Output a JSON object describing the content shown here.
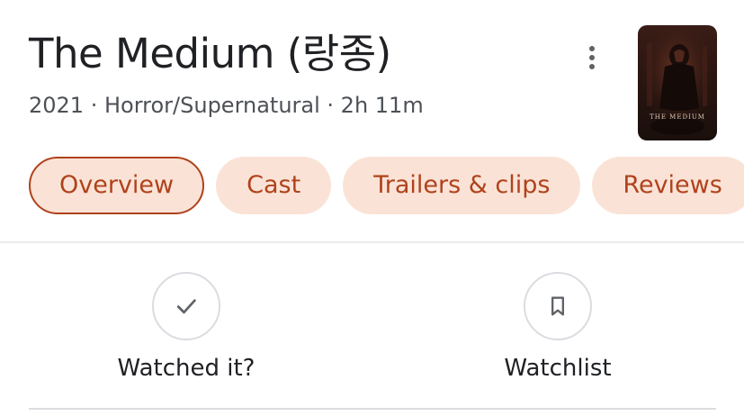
{
  "movie": {
    "title": "The Medium (랑종)",
    "meta": "2021 · Horror/Supernatural · 2h 11m",
    "poster_text": "THE MEDIUM"
  },
  "menu": {
    "icon": "more-vert-icon"
  },
  "tabs": [
    {
      "label": "Overview",
      "active": true
    },
    {
      "label": "Cast",
      "active": false
    },
    {
      "label": "Trailers & clips",
      "active": false
    },
    {
      "label": "Reviews",
      "active": false
    }
  ],
  "actions": {
    "watched": {
      "label": "Watched it?",
      "icon": "check-icon"
    },
    "watchlist": {
      "label": "Watchlist",
      "icon": "bookmark-icon"
    }
  },
  "colors": {
    "accent": "#b0421c",
    "chip_bg": "#fae3d6",
    "text_primary": "#202124",
    "text_secondary": "#4d5156"
  }
}
